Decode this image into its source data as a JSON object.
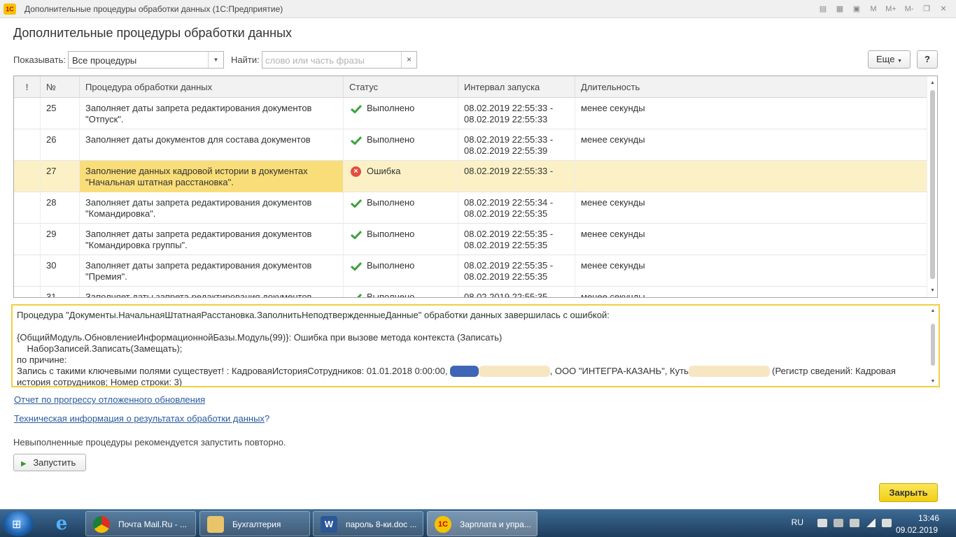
{
  "window": {
    "logo": "1С",
    "title": "Дополнительные процедуры обработки данных  (1С:Предприятие)",
    "tools": [
      "M",
      "M+",
      "M-"
    ]
  },
  "page_title": "Дополнительные процедуры обработки данных",
  "filter": {
    "show_label": "Показывать:",
    "show_value": "Все процедуры",
    "find_label": "Найти:",
    "find_placeholder": "слово или часть фразы",
    "more_label": "Еще",
    "help_label": "?"
  },
  "table": {
    "headers": [
      "!",
      "№",
      "Процедура обработки данных",
      "Статус",
      "Интервал запуска",
      "Длительность"
    ],
    "rows": [
      {
        "num": "25",
        "proc": "Заполняет даты запрета редактирования документов\n\"Отпуск\".",
        "status": "Выполнено",
        "state": "ok",
        "interval": "08.02.2019 22:55:33 -\n08.02.2019 22:55:33",
        "duration": "менее секунды"
      },
      {
        "num": "26",
        "proc": "Заполняет даты документов для состава документов",
        "status": "Выполнено",
        "state": "ok",
        "interval": "08.02.2019 22:55:33 -\n08.02.2019 22:55:39",
        "duration": "менее секунды"
      },
      {
        "num": "27",
        "proc": "Заполнение данных кадровой истории в документах\n\"Начальная штатная расстановка\".",
        "status": "Ошибка",
        "state": "error",
        "interval": "08.02.2019 22:55:33 -",
        "duration": ""
      },
      {
        "num": "28",
        "proc": "Заполняет даты запрета редактирования документов\n\"Командировка\".",
        "status": "Выполнено",
        "state": "ok",
        "interval": "08.02.2019 22:55:34 -\n08.02.2019 22:55:35",
        "duration": "менее секунды"
      },
      {
        "num": "29",
        "proc": "Заполняет даты запрета редактирования документов\n\"Командировка группы\".",
        "status": "Выполнено",
        "state": "ok",
        "interval": "08.02.2019 22:55:35 -\n08.02.2019 22:55:35",
        "duration": "менее секунды"
      },
      {
        "num": "30",
        "proc": "Заполняет даты запрета редактирования документов\n\"Премия\".",
        "status": "Выполнено",
        "state": "ok",
        "interval": "08.02.2019 22:55:35 -\n08.02.2019 22:55:35",
        "duration": "менее секунды"
      },
      {
        "num": "31",
        "proc": "Заполняет даты запрета редактирования документов",
        "status": "Выполнено",
        "state": "ok",
        "interval": "08.02.2019 22:55:35 -",
        "duration": "менее секунды"
      }
    ]
  },
  "error_message": {
    "line1": "Процедура \"Документы.НачальнаяШтатнаяРасстановка.ЗаполнитьНеподтвержденныеДанные\" обработки данных завершилась с ошибкой:",
    "line2": "{ОбщийМодуль.ОбновлениеИнформационнойБазы.Модуль(99)}: Ошибка при вызове метода контекста (Записать)",
    "line3": "    НаборЗаписей.Записать(Замещать);",
    "line4": "по причине:",
    "line5a": "Запись с такими ключевыми полями существует! : КадроваяИсторияСотрудников: 01.01.2018 0:00:00, ",
    "line5b": ", ООО \"ИНТЕГРА-КАЗАНЬ\", Куть",
    "line5c": " (Регистр сведений: Кадровая",
    "line6": "история сотрудников; Номер строки: 3)"
  },
  "links": {
    "progress_report": "Отчет по прогрессу отложенного обновления",
    "tech_info": "Техническая информация о результатах обработки данных",
    "tech_info_help": "?"
  },
  "hint": "Невыполненные процедуры рекомендуется запустить повторно.",
  "run_button": "Запустить",
  "close_button": "Закрыть",
  "taskbar": {
    "items": [
      "Почта Mail.Ru - ...",
      "Бухгалтерия",
      "пароль 8-ки.doc ...",
      "Зарплата и упра..."
    ],
    "lang": "RU",
    "time": "13:46",
    "date": "09.02.2019"
  }
}
